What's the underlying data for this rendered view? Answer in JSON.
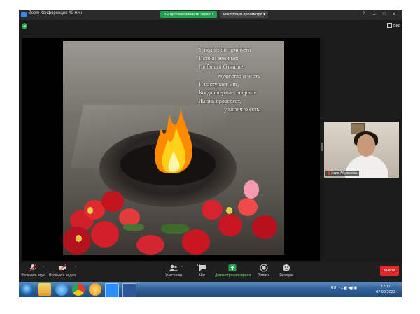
{
  "window": {
    "title": "Zoom Конференция  40 мин",
    "share_banner": "Вы просматриваете экран 1",
    "view_options": "Настройки просмотра ▾",
    "view_label": "Вид"
  },
  "slide": {
    "lines": [
      "У подножия вечности",
      "Истоки вековые:",
      "Любовь к Отчизне,",
      "мужество и честь",
      "И наступает миг,",
      "Когда впервые, впервые",
      "Жизнь проверяет,",
      "у кого что есть."
    ]
  },
  "participant": {
    "name": "Асия Абуханова"
  },
  "toolbar": {
    "unmute": "Включить звук",
    "start_video": "Включить видео",
    "participants": "Участники",
    "participants_count": "15",
    "chat": "Чат",
    "share_screen": "Демонстрация экрана",
    "record": "Запись",
    "reactions": "Реакции",
    "end": "Выйти"
  },
  "taskbar": {
    "language": "RU",
    "time": "12:17",
    "date": "07.02.2022"
  },
  "colors": {
    "accent_green": "#23a24d",
    "end_red": "#e02828",
    "zoom_blue": "#2d8cff"
  },
  "icons": [
    "zoom-icon",
    "shield-icon",
    "view-icon",
    "mic-muted-icon",
    "video-off-icon",
    "participants-icon",
    "chat-icon",
    "share-screen-icon",
    "record-icon",
    "reactions-icon",
    "start-icon",
    "explorer-icon",
    "ie-icon",
    "chrome-icon",
    "media-icon",
    "zoom-app-icon",
    "word-icon"
  ]
}
